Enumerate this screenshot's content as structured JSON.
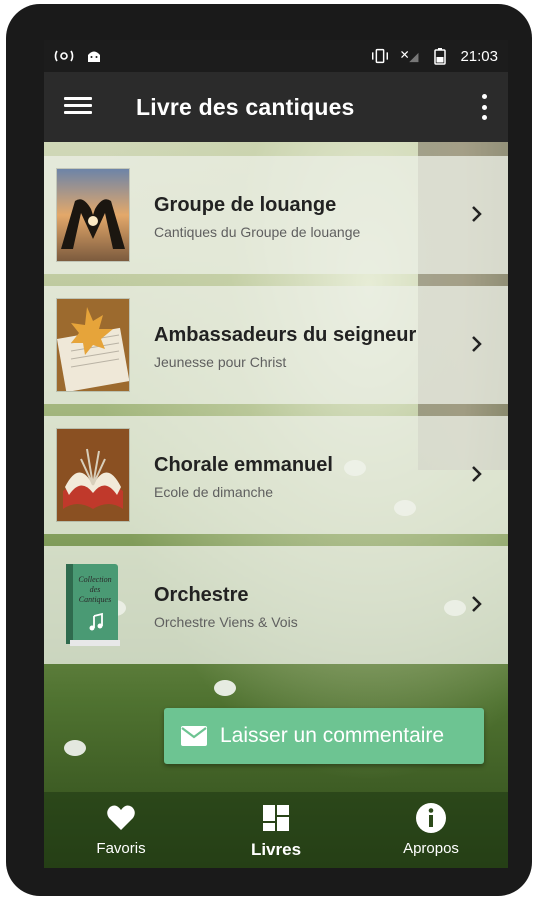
{
  "status_bar": {
    "time": "21:03",
    "left_icons": [
      "wifi-calling-icon",
      "android-icon"
    ],
    "right_icons": [
      "vibrate-icon",
      "signal-icon",
      "battery-icon"
    ]
  },
  "toolbar": {
    "title": "Livre des cantiques",
    "menu_icon": "hamburger-menu-icon",
    "overflow_icon": "more-vert-icon"
  },
  "items": [
    {
      "title": "Groupe de louange",
      "subtitle": "Cantiques du Groupe de louange",
      "thumb": "heart-hands-image"
    },
    {
      "title": "Ambassadeurs du seigneur",
      "subtitle": "Jeunesse pour Christ",
      "thumb": "maple-leaf-book-image"
    },
    {
      "title": "Chorale emmanuel",
      "subtitle": "Ecole de dimanche",
      "thumb": "open-book-image"
    },
    {
      "title": "Orchestre",
      "subtitle": "Orchestre Viens & Vois",
      "thumb": "green-songbook-image",
      "thumb_text": [
        "Collection",
        "des",
        "Cantiques"
      ]
    }
  ],
  "fab": {
    "label": "Laisser un commentaire",
    "icon": "email-icon"
  },
  "bottom_nav": [
    {
      "label": "Favoris",
      "icon": "heart-icon"
    },
    {
      "label": "Livres",
      "icon": "grid-icon"
    },
    {
      "label": "Apropos",
      "icon": "info-icon"
    }
  ],
  "colors": {
    "toolbar": "#2b2b2b",
    "fab": "#6dc492",
    "status_bar": "#1c1c1c"
  }
}
